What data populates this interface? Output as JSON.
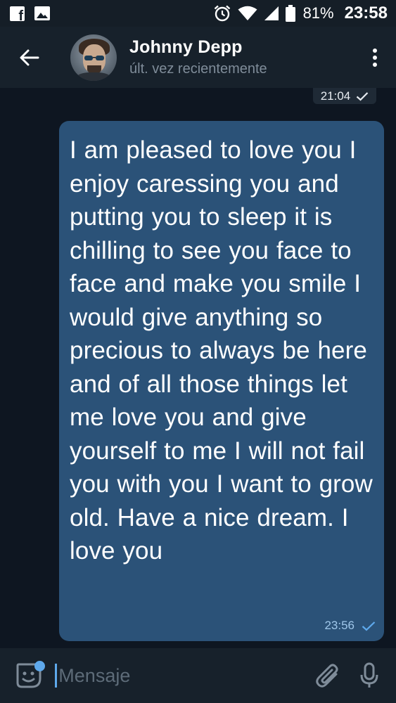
{
  "status_bar": {
    "battery_percent": "81%",
    "time": "23:58",
    "icons": [
      "facebook-icon",
      "gallery-icon",
      "alarm-icon",
      "wifi-icon",
      "signal-icon",
      "battery-icon"
    ]
  },
  "header": {
    "contact_name": "Johnny Depp",
    "last_seen": "últ. vez recientemente",
    "icons": [
      "back-arrow-icon",
      "avatar",
      "more-vert-icon"
    ]
  },
  "chat": {
    "previous_time": "21:04",
    "message": {
      "text": "I am pleased to love you I enjoy caressing you and putting you to sleep it is chilling to see you face to face and make you smile I would give anything so precious to always be here and of all those things let me love you and give yourself to me I will not fail you with you I want to grow old. Have a nice dream. I love you",
      "time": "23:56",
      "status": "sent"
    }
  },
  "input_bar": {
    "placeholder": "Mensaje",
    "icons": [
      "sticker-icon",
      "attach-icon",
      "mic-icon"
    ]
  },
  "colors": {
    "background": "#0e1621",
    "header": "#17212b",
    "bubble": "#2b5278",
    "accent": "#5ea9ec",
    "muted": "#7f8c99"
  }
}
